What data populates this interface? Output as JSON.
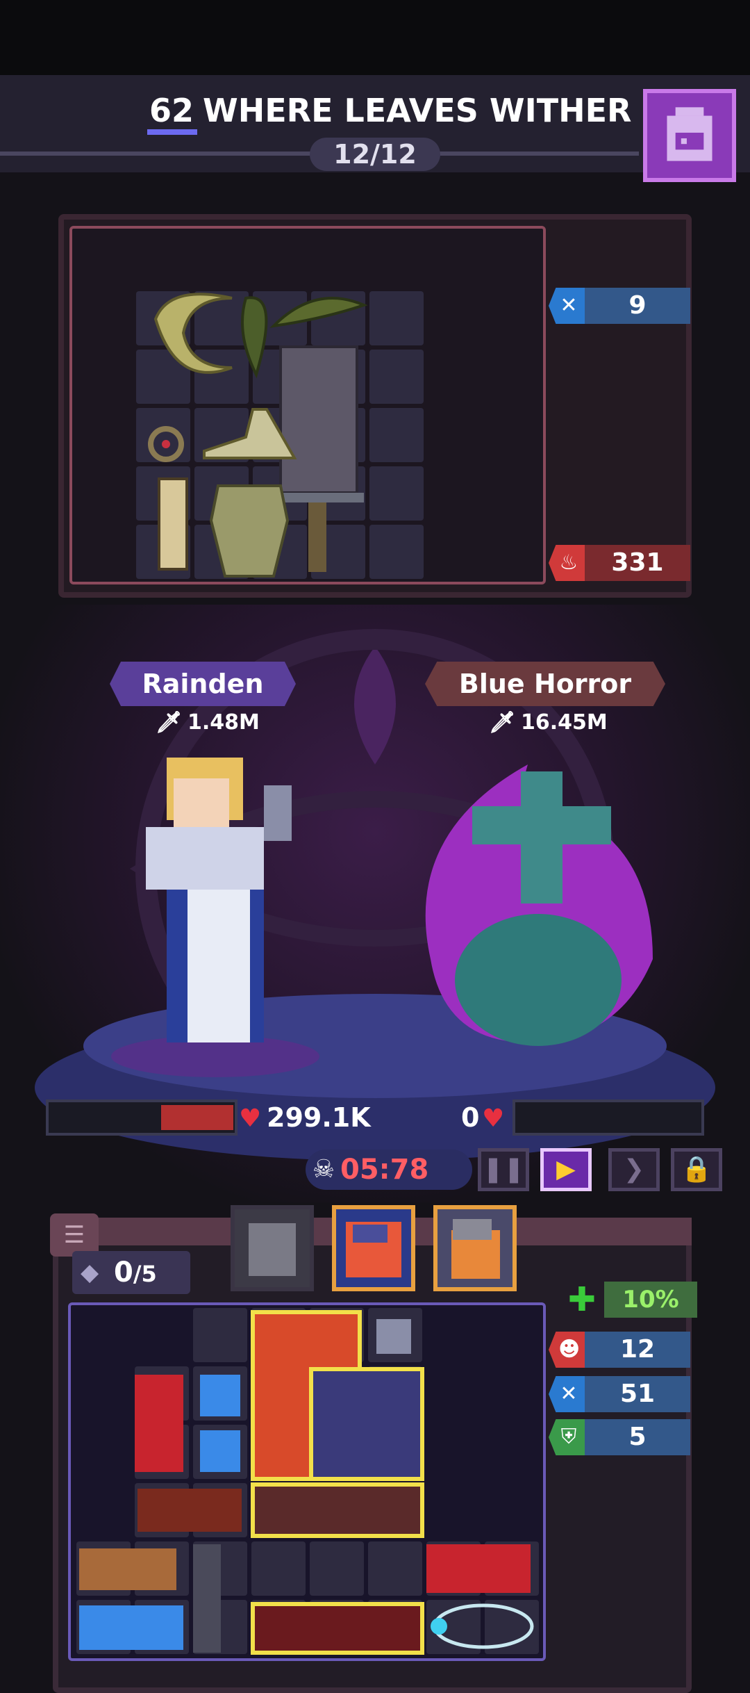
{
  "header": {
    "level": "62",
    "title": "WHERE LEAVES WITHER",
    "stage": "12/12",
    "backpack_icon": "backpack-icon"
  },
  "enemy_stats": {
    "crit": "9",
    "rage": "331"
  },
  "player": {
    "name": "Rainden",
    "power": "1.48M",
    "hp": "299.1K"
  },
  "enemy": {
    "name": "Blue Horror",
    "power": "16.45M",
    "hp": "0"
  },
  "battle": {
    "timer": "05:78",
    "controls": [
      "pause",
      "play",
      "fast-forward",
      "lock"
    ]
  },
  "bag": {
    "slots_used": "0",
    "slots_total": "/5",
    "regen": "10%",
    "stats": {
      "attack": "12",
      "crit": "51",
      "defense": "5"
    }
  },
  "colors": {
    "accent_purple": "#8a3ab8",
    "stat_blue": "#33588a",
    "rage_red": "#7a2a2e",
    "hp_red": "#b23030",
    "timer_red": "#ff5e64",
    "highlight_yellow": "#f2e04a"
  }
}
